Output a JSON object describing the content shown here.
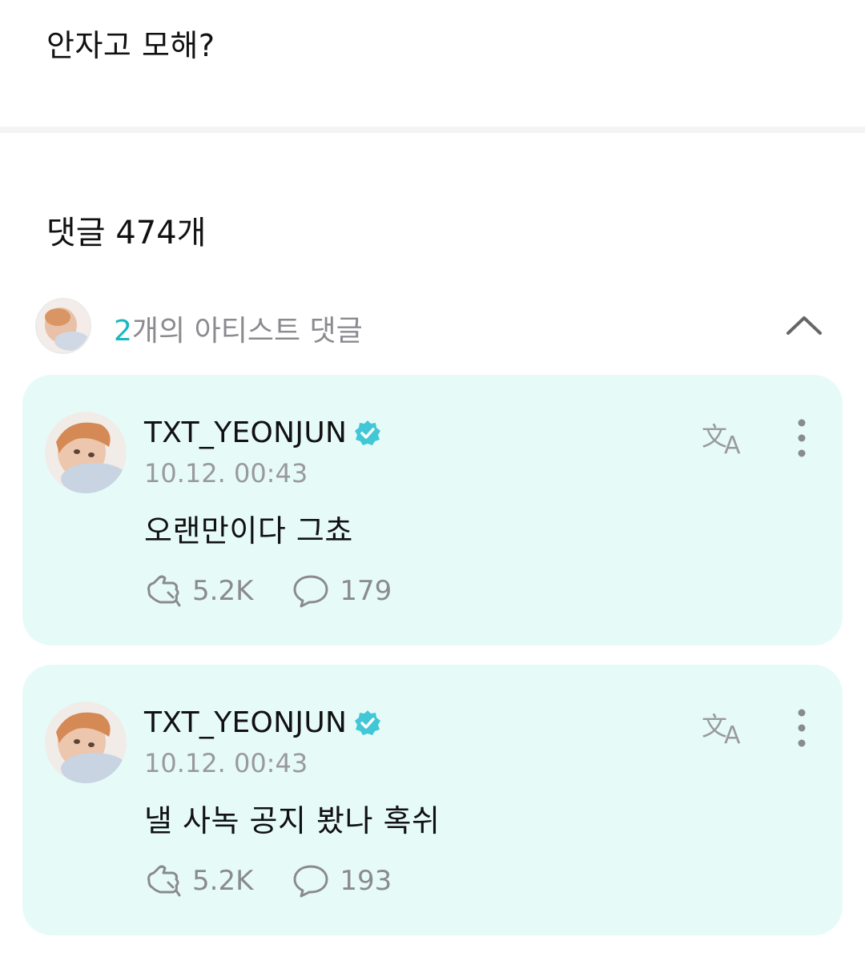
{
  "post": {
    "text": "안자고 모해?"
  },
  "comments_header": {
    "title": "댓글 474개"
  },
  "artist_comments": {
    "count": "2",
    "label": "개의 아티스트 댓글"
  },
  "comments": [
    {
      "username": "TXT_YEONJUN",
      "timestamp": "10.12. 00:43",
      "text": "오랜만이다 그쵸",
      "likes": "5.2K",
      "replies": "179"
    },
    {
      "username": "TXT_YEONJUN",
      "timestamp": "10.12. 00:43",
      "text": "낼 사녹 공지 봤나 혹쉬",
      "likes": "5.2K",
      "replies": "193"
    }
  ],
  "icons": {
    "verified": "verified-badge-icon",
    "translate": "translate-icon",
    "more": "more-vertical-icon",
    "like": "like-hand-icon",
    "reply": "speech-bubble-icon",
    "collapse": "chevron-up-icon"
  },
  "colors": {
    "accent": "#16b9c0",
    "card_bg": "#e6fbf8",
    "verified": "#41c7d6",
    "muted_text": "#8a8a8f"
  }
}
